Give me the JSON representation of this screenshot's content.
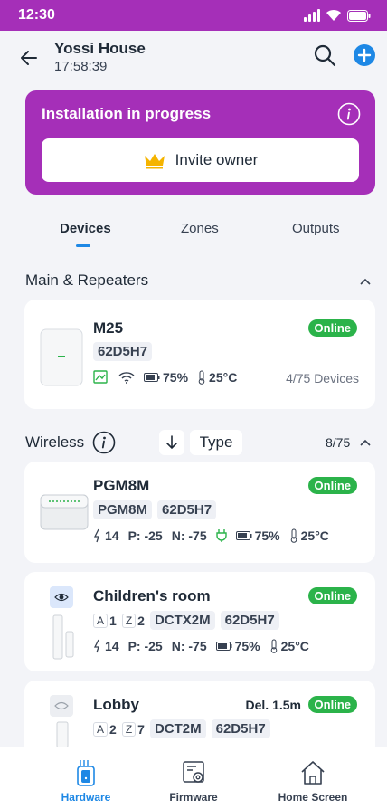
{
  "status_bar": {
    "time": "12:30"
  },
  "header": {
    "title": "Yossi House",
    "subtitle": "17:58:39"
  },
  "install_banner": {
    "title": "Installation in progress",
    "invite_label": "Invite owner"
  },
  "tabs": [
    {
      "label": "Devices",
      "active": true
    },
    {
      "label": "Zones",
      "active": false
    },
    {
      "label": "Outputs",
      "active": false
    }
  ],
  "sections": {
    "main": {
      "title": "Main & Repeaters"
    },
    "wireless": {
      "title": "Wireless",
      "sort_label": "Type",
      "count": "8/75"
    }
  },
  "main_device": {
    "name": "M25",
    "status": "Online",
    "serial": "62D5H7",
    "battery": "75%",
    "temperature": "25°C",
    "devices": "4/75 Devices"
  },
  "wireless_devices": [
    {
      "name": "PGM8M",
      "status": "Online",
      "chips": [
        "PGM8M",
        "62D5H7"
      ],
      "signal": "14",
      "p": "P: -25",
      "n": "N: -75",
      "battery": "75%",
      "temperature": "25°C"
    },
    {
      "name": "Children's room",
      "status": "Online",
      "area": "A",
      "area_num": "1",
      "zone": "Z",
      "zone_num": "2",
      "model": "DCTX2M",
      "serial": "62D5H7",
      "signal": "14",
      "p": "P: -25",
      "n": "N: -75",
      "battery": "75%",
      "temperature": "25°C"
    },
    {
      "name": "Lobby",
      "status": "Online",
      "delay": "Del. 1.5m",
      "area": "A",
      "area_num": "2",
      "zone": "Z",
      "zone_num": "7",
      "model": "DCT2M",
      "serial": "62D5H7"
    }
  ],
  "bottom_nav": [
    {
      "label": "Hardware",
      "active": true
    },
    {
      "label": "Firmware",
      "active": false
    },
    {
      "label": "Home Screen",
      "active": false
    }
  ],
  "colors": {
    "brand": "#a52fb8",
    "online": "#2bb34a",
    "accent": "#1e88e5",
    "crown": "#f5b400"
  }
}
